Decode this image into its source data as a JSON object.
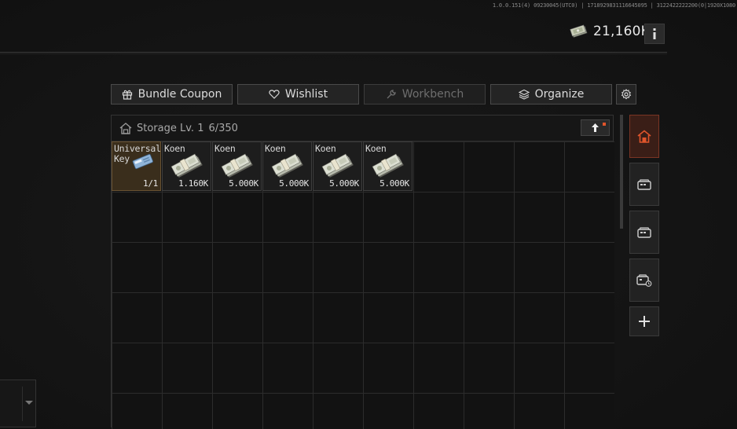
{
  "build_info": "1.0.0.151(4) 09230045(UTC0) | 1718929831116645095 | 3122422222200(0|1920X1080",
  "currency": {
    "amount": "21,160K",
    "icon": "koen-money-icon"
  },
  "toolbar": {
    "bundle_coupon": "Bundle Coupon",
    "wishlist": "Wishlist",
    "workbench": "Workbench",
    "organize": "Organize"
  },
  "storage": {
    "title": "Storage Lv. 1",
    "capacity": "6/350",
    "items": [
      {
        "name": "Universal Key",
        "name_line1": "Universal",
        "name_line2": "Key",
        "qty": "1/1",
        "icon": "key-card-icon"
      },
      {
        "name": "Koen",
        "qty": "1.160K",
        "icon": "money-stack-icon"
      },
      {
        "name": "Koen",
        "qty": "5.000K",
        "icon": "money-stack-icon"
      },
      {
        "name": "Koen",
        "qty": "5.000K",
        "icon": "money-stack-icon"
      },
      {
        "name": "Koen",
        "qty": "5.000K",
        "icon": "money-stack-icon"
      },
      {
        "name": "Koen",
        "qty": "5.000K",
        "icon": "money-stack-icon"
      }
    ]
  },
  "sidebar": {
    "items": [
      {
        "name": "storage-home",
        "icon": "home-storage-icon",
        "active": true
      },
      {
        "name": "container-1",
        "icon": "container-icon"
      },
      {
        "name": "container-2",
        "icon": "container-icon"
      },
      {
        "name": "container-3",
        "icon": "container-lock-icon"
      },
      {
        "name": "add",
        "icon": "plus-icon"
      }
    ]
  },
  "colors": {
    "accent": "#e0552b",
    "active_tab": "#3a1e17",
    "key_cell": "#3a2e1c"
  }
}
